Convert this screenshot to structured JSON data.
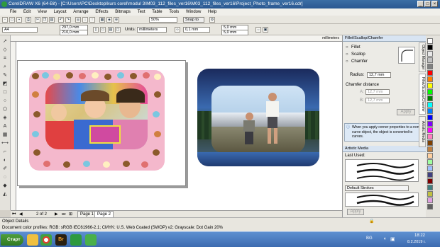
{
  "window": {
    "title": "CorelDRAW X6 (64-Bit) - [C:\\Users\\PC\\Desktop\\kurs corel\\modul 3\\M03_112_files_ver16\\M03_112_files_ver16\\Project_Photo_frame_ver16.cdr]"
  },
  "menu": [
    "File",
    "Edit",
    "View",
    "Layout",
    "Arrange",
    "Effects",
    "Bitmaps",
    "Text",
    "Table",
    "Tools",
    "Window",
    "Help"
  ],
  "standard": {
    "zoom": "50%",
    "snap": "Snap to"
  },
  "property": {
    "page_size": "A4",
    "width": "297,0 mm",
    "height": "210,0 mm",
    "units_label": "Units:",
    "units_value": "millimeters",
    "nudge": "0,1 mm",
    "dup_x": "5,0 mm",
    "dup_y": "5,0 mm"
  },
  "ruler": {
    "unit": "millimeters"
  },
  "docker": {
    "fillet_title": "Fillet/Scallop/Chamfer",
    "options": [
      "Fillet",
      "Scallop",
      "Chamfer"
    ],
    "radius_label": "Radius:",
    "radius_value": "12,7 mm",
    "chamfer_label": "Chamfer distance",
    "a_label": "A:",
    "a_value": "12,7 mm",
    "b_label": "B:",
    "b_value": "12,7 mm",
    "apply": "Apply",
    "info": "When you apply corner properties to a non-curve object, the object is converted to curves.",
    "artistic_title": "Artistic Media",
    "last_used": "Last Used:",
    "default_strokes": "Default Strokes",
    "apply2": "Apply"
  },
  "vtabs": [
    "Object Manager",
    "Fillet/Scallop/Chamfer",
    "Artistic Media"
  ],
  "pages": {
    "count": "2 of 2",
    "tab1": "Page 1",
    "tab2": "Page 2"
  },
  "status": {
    "details": "Object Details",
    "profiles": "Document color profiles: RGB: sRGB IEC61966-2.1; CMYK: U.S. Web Coated (SWOP) v2; Grayscale: Dot Gain 20%"
  },
  "taskbar": {
    "start": "Старт",
    "lang": "BG",
    "time": "18:22",
    "date": "8.2.2019 г."
  },
  "palette": [
    "#ffffff",
    "#000000",
    "#e8e8e8",
    "#c0c0c0",
    "#808080",
    "#ff0000",
    "#ff8000",
    "#ffff00",
    "#00ff00",
    "#008000",
    "#00ffff",
    "#0080ff",
    "#0000ff",
    "#8000ff",
    "#ff00ff",
    "#ff80c0",
    "#804000",
    "#c08040",
    "#ffd0a0",
    "#a0ffa0",
    "#a0c0ff",
    "#404080",
    "#800000",
    "#408080",
    "#c0c040",
    "#e0a0e0",
    "#606060"
  ]
}
